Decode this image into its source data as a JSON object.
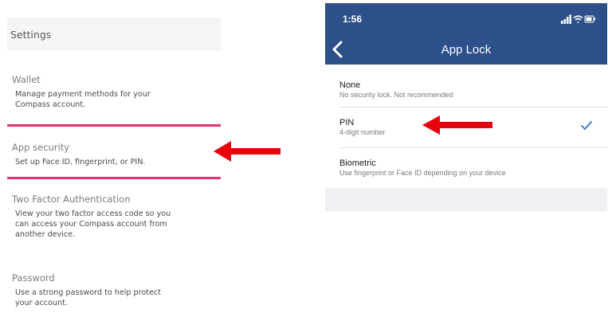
{
  "settings": {
    "title": "Settings",
    "items": [
      {
        "title": "Wallet",
        "desc": "Manage payment methods for your\nCompass account."
      },
      {
        "title": "App security",
        "desc": "Set up Face ID, fingerprint, or PIN."
      },
      {
        "title": "Two Factor Authentication",
        "desc": "View your two factor access code so you\ncan access your Compass account from\nanother device."
      },
      {
        "title": "Password",
        "desc": "Use a strong password to help protect\nyour account."
      }
    ]
  },
  "app_lock": {
    "status_time": "1:56",
    "title": "App Lock",
    "back_icon": "chevron-left-icon",
    "options": [
      {
        "title": "None",
        "subtitle": "No security lock. Not recommended"
      },
      {
        "title": "PIN",
        "subtitle": "4-digit number",
        "selected": true
      },
      {
        "title": "Biometric",
        "subtitle": "Use fingerprint or Face ID depending on your device"
      }
    ]
  },
  "colors": {
    "header_blue": "#2c5089",
    "highlight_pink": "#e2336f",
    "arrow_red": "#e8000b",
    "check_blue": "#3b73d6"
  }
}
